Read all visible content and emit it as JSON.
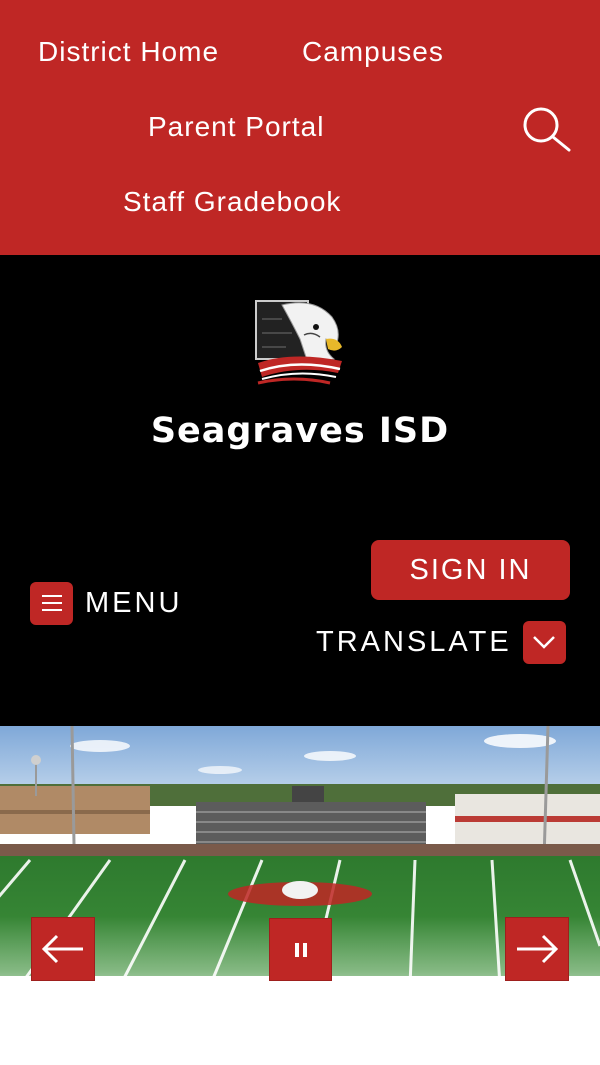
{
  "top_nav": {
    "links": [
      "District Home",
      "Campuses",
      "Parent Portal",
      "Staff Gradebook"
    ]
  },
  "header": {
    "title": "Seagraves ISD",
    "logo_icon": "eagle-mascot-logo",
    "menu_label": "MENU",
    "sign_in_label": "SIGN IN",
    "translate_label": "TRANSLATE"
  },
  "hero": {
    "description_icon": "football-field-photo",
    "controls": {
      "prev_icon": "arrow-left-icon",
      "pause_icon": "pause-icon",
      "next_icon": "arrow-right-icon"
    }
  },
  "colors": {
    "brand_red": "#bf2725",
    "header_black": "#000000",
    "text_white": "#ffffff"
  }
}
